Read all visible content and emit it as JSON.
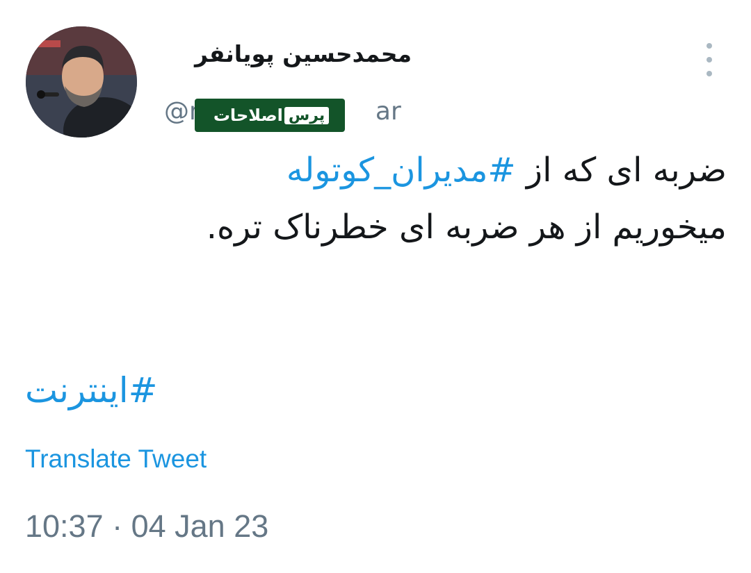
{
  "author": {
    "display_name": "محمدحسین پویانفر",
    "handle": "@mbpouyanfar",
    "handle_visible_start": "@mb",
    "handle_visible_end": "ar",
    "avatar_icon": "person-avatar"
  },
  "watermark": {
    "part1": "اصلاحات",
    "part2": "پرس"
  },
  "tweet": {
    "line1_text": "ضربه ای که از ",
    "line1_hashtag": "#مدیران_کوتوله",
    "line2_text": "میخوریم از هر ضربه ای خطرناک تره.",
    "hashtag2": "#اینترنت"
  },
  "actions": {
    "translate_label": "Translate Tweet",
    "more_icon": "more-vertical-icon"
  },
  "meta": {
    "timestamp": "10:37 · 04 Jan 23"
  },
  "colors": {
    "link": "#1b95e0",
    "text": "#14171a",
    "muted": "#657786",
    "watermark_bg": "#135429"
  }
}
